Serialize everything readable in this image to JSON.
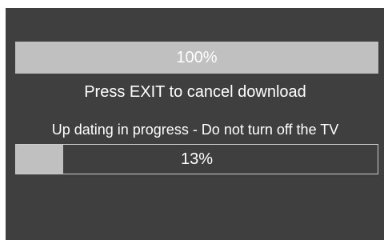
{
  "download": {
    "progress_label": "100%",
    "progress_fraction": 1.0
  },
  "cancel_message": "Press EXIT to cancel download",
  "update": {
    "status_message": "Up dating in progress - Do not turn off the TV",
    "progress_label": "13%",
    "progress_fraction": 0.13
  },
  "colors": {
    "screen_background": "#3f3f3f",
    "bar_fill": "#c0c0c0",
    "bar_border": "#c9c9c9",
    "text": "#ffffff"
  }
}
